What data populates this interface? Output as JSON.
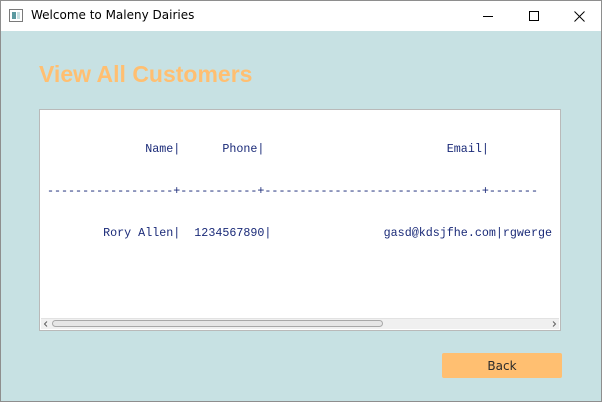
{
  "window": {
    "title": "Welcome to Maleny Dairies",
    "controls": {
      "minimize": "minimize-icon",
      "maximize": "maximize-icon",
      "close": "close-icon"
    }
  },
  "page": {
    "heading": "View All Customers"
  },
  "customers_text": {
    "lines": [
      "              Name|      Phone|                          Email|",
      "------------------+-----------+-------------------------------+-------",
      "        Rory Allen|  1234567890|                gasd@kdsjfhe.com|rgwerge"
    ]
  },
  "buttons": {
    "back": "Back"
  },
  "colors": {
    "background": "#c7e1e3",
    "accent": "#ffbf71",
    "text": "#1a2a78"
  }
}
